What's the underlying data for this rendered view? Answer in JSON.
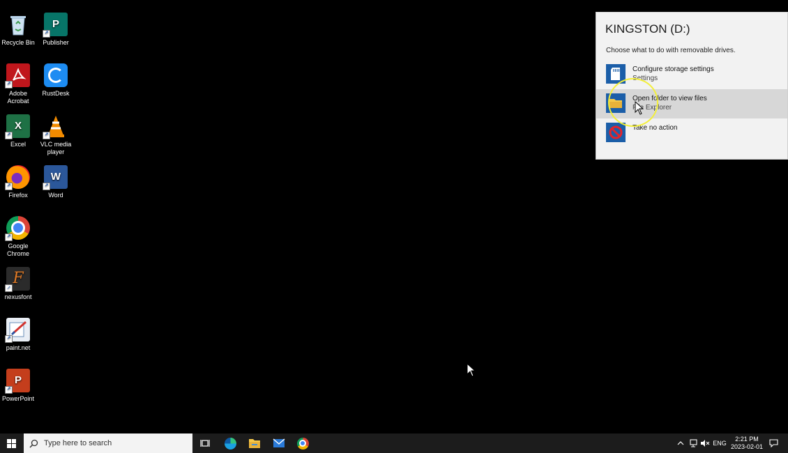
{
  "desktop": {
    "icons": [
      {
        "label": "Recycle Bin"
      },
      {
        "label": "Publisher"
      },
      {
        "label": "Adobe Acrobat"
      },
      {
        "label": "RustDesk"
      },
      {
        "label": "Excel"
      },
      {
        "label": "VLC media player"
      },
      {
        "label": "Firefox"
      },
      {
        "label": "Word"
      },
      {
        "label": "Google Chrome"
      },
      {
        "label": "nexusfont"
      },
      {
        "label": "paint.net"
      },
      {
        "label": "PowerPoint"
      }
    ]
  },
  "autoplay": {
    "title": "KINGSTON (D:)",
    "subtitle": "Choose what to do with removable drives.",
    "options": [
      {
        "title": "Configure storage settings",
        "subtitle": "Settings"
      },
      {
        "title": "Open folder to view files",
        "subtitle": "File Explorer"
      },
      {
        "title": "Take no action",
        "subtitle": ""
      }
    ]
  },
  "taskbar": {
    "search_placeholder": "Type here to search",
    "language": "ENG",
    "time": "2:21 PM",
    "date": "2023-02-01"
  }
}
